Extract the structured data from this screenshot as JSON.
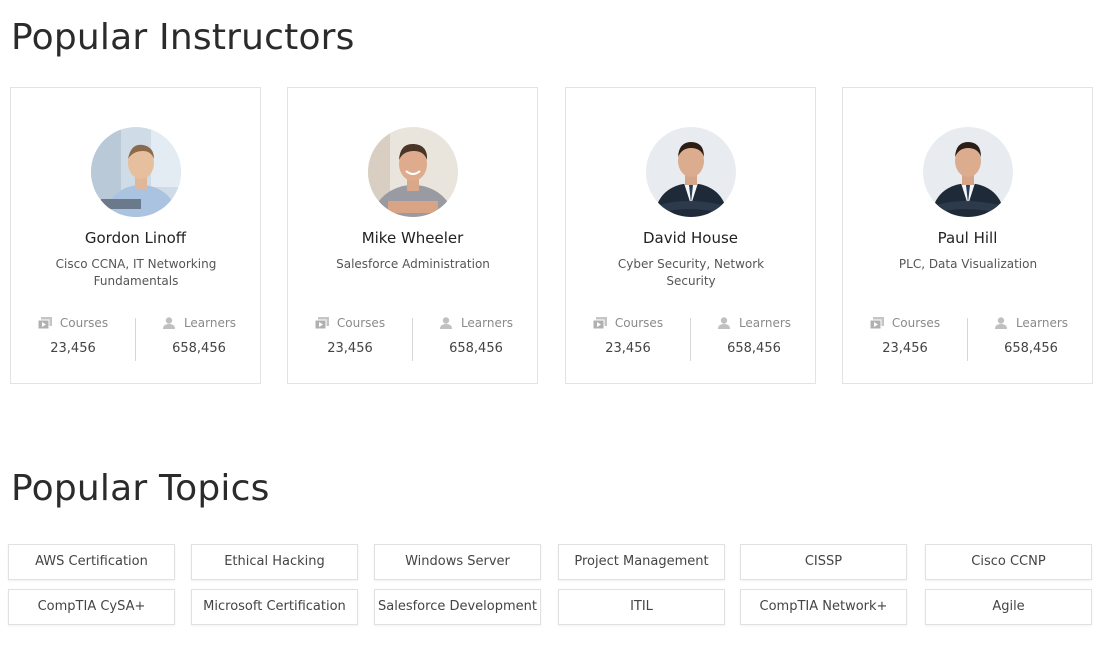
{
  "sections": {
    "instructors_title": "Popular Instructors",
    "topics_title": "Popular Topics"
  },
  "stat_labels": {
    "courses": "Courses",
    "learners": "Learners"
  },
  "instructors": [
    {
      "name": "Gordon Linoff",
      "subtitle": "Cisco CCNA, IT Networking Fundamentals",
      "courses": "23,456",
      "learners": "658,456"
    },
    {
      "name": "Mike Wheeler",
      "subtitle": "Salesforce Administration",
      "courses": "23,456",
      "learners": "658,456"
    },
    {
      "name": "David House",
      "subtitle": "Cyber Security, Network Security",
      "courses": "23,456",
      "learners": "658,456"
    },
    {
      "name": "Paul Hill",
      "subtitle": "PLC, Data Visualization",
      "courses": "23,456",
      "learners": "658,456"
    }
  ],
  "topics": [
    "AWS Certification",
    "Ethical Hacking",
    "Windows Server",
    "Project Management",
    "CISSP",
    "Cisco CCNP",
    "CompTIA CySA+",
    "Microsoft Certification",
    "Salesforce Development",
    "ITIL",
    "CompTIA Network+",
    "Agile"
  ],
  "icons": {
    "courses": "video-library-icon",
    "learners": "person-icon"
  },
  "colors": {
    "border": "#e3e3e3",
    "muted_text": "#8a8a8a"
  }
}
